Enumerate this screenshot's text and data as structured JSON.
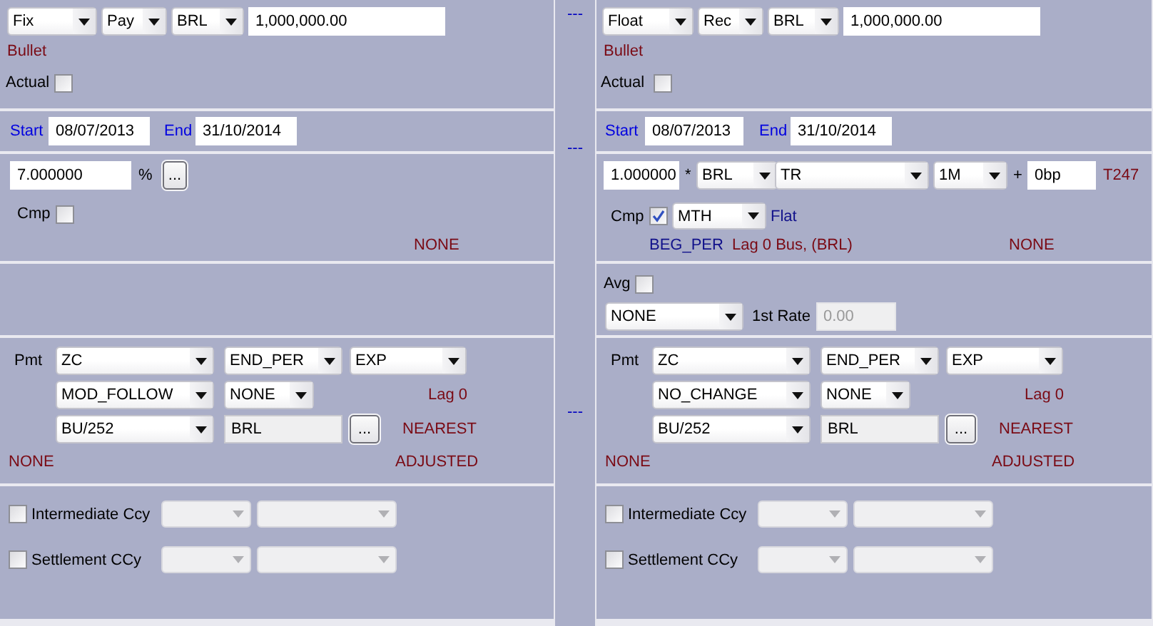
{
  "legs": [
    {
      "header": {
        "rows": [
          {
            "items": [
              {
                "kind": "dropdown",
                "value": "Fix",
                "disabled": false
              },
              {
                "kind": "dropdown",
                "value": "Pay",
                "disabled": false
              },
              {
                "kind": "dropdown",
                "value": "BRL",
                "disabled": false
              },
              {
                "kind": "field",
                "value": "1,000,000.00",
                "disabled": false,
                "readonly": false
              }
            ]
          },
          {
            "items": [
              {
                "kind": "hint",
                "text": "Bullet"
              }
            ]
          },
          {
            "items": [
              {
                "kind": "label",
                "text": "Actual"
              },
              {
                "kind": "checkbox",
                "checked": false
              }
            ]
          }
        ]
      },
      "dates": {
        "rows": [
          {
            "items": [
              {
                "kind": "caption",
                "text": "Start"
              },
              {
                "kind": "field",
                "value": "08/07/2013",
                "disabled": false,
                "readonly": false
              },
              {
                "kind": "caption",
                "text": "End"
              },
              {
                "kind": "field",
                "value": "31/10/2014",
                "disabled": false,
                "readonly": false
              }
            ]
          }
        ]
      },
      "rate": {
        "rows": [
          {
            "items": [
              {
                "kind": "field",
                "value": "7.000000",
                "disabled": false,
                "readonly": false
              },
              {
                "kind": "label",
                "text": "%"
              },
              {
                "kind": "button",
                "label": "..."
              }
            ]
          },
          {
            "items": [
              {
                "kind": "label",
                "text": "Cmp"
              },
              {
                "kind": "checkbox",
                "checked": false
              }
            ]
          },
          {
            "items": [
              {
                "kind": "hint",
                "text": "NONE"
              }
            ]
          }
        ]
      },
      "payment": {
        "rows": [
          {
            "items": [
              {
                "kind": "label",
                "text": "Pmt"
              },
              {
                "kind": "dropdown",
                "value": "ZC",
                "disabled": false
              },
              {
                "kind": "dropdown",
                "value": "END_PER",
                "disabled": false
              },
              {
                "kind": "dropdown",
                "value": "EXP",
                "disabled": false
              }
            ]
          },
          {
            "items": [
              {
                "kind": "dropdown",
                "value": "MOD_FOLLOW",
                "disabled": false
              },
              {
                "kind": "dropdown",
                "value": "NONE",
                "disabled": false
              },
              {
                "kind": "hint",
                "text": "Lag 0"
              }
            ]
          },
          {
            "items": [
              {
                "kind": "dropdown",
                "value": "BU/252",
                "disabled": false
              },
              {
                "kind": "field",
                "value": "BRL",
                "disabled": false,
                "readonly": true
              },
              {
                "kind": "button",
                "label": "..."
              },
              {
                "kind": "hint",
                "text": "NEAREST"
              }
            ]
          },
          {
            "items": [
              {
                "kind": "hint",
                "text": "NONE"
              },
              {
                "kind": "hint",
                "text": "ADJUSTED"
              }
            ]
          }
        ]
      },
      "currencies": {
        "rows": [
          {
            "items": [
              {
                "kind": "checkbox",
                "checked": false
              },
              {
                "kind": "label",
                "text": "Intermediate Ccy"
              },
              {
                "kind": "dropdown",
                "disabled": true
              },
              {
                "kind": "dropdown",
                "disabled": true
              }
            ]
          },
          {
            "items": [
              {
                "kind": "checkbox",
                "checked": false
              },
              {
                "kind": "label",
                "text": "Settlement CCy"
              },
              {
                "kind": "dropdown",
                "disabled": true
              },
              {
                "kind": "dropdown",
                "disabled": true
              }
            ]
          }
        ]
      }
    },
    {
      "header": {
        "rows": [
          {
            "items": [
              {
                "kind": "dropdown",
                "value": "Float",
                "disabled": false
              },
              {
                "kind": "dropdown",
                "value": "Rec",
                "disabled": false
              },
              {
                "kind": "dropdown",
                "value": "BRL",
                "disabled": false
              },
              {
                "kind": "field",
                "value": "1,000,000.00",
                "disabled": false,
                "readonly": false
              }
            ]
          },
          {
            "items": [
              {
                "kind": "hint",
                "text": "Bullet"
              }
            ]
          },
          {
            "items": [
              {
                "kind": "label",
                "text": "Actual"
              },
              {
                "kind": "checkbox",
                "checked": false
              }
            ]
          }
        ]
      },
      "dates": {
        "rows": [
          {
            "items": [
              {
                "kind": "caption",
                "text": "Start"
              },
              {
                "kind": "field",
                "value": "08/07/2013",
                "disabled": false,
                "readonly": false
              },
              {
                "kind": "caption",
                "text": "End"
              },
              {
                "kind": "field",
                "value": "31/10/2014",
                "disabled": false,
                "readonly": false
              }
            ]
          }
        ]
      },
      "rate": {
        "rows": [
          {
            "items": [
              {
                "kind": "field",
                "value": "1.000000",
                "disabled": false,
                "readonly": false
              },
              {
                "kind": "label",
                "text": "*"
              },
              {
                "kind": "dropdown",
                "value": "BRL",
                "disabled": false
              },
              {
                "kind": "dropdown",
                "value": "TR",
                "disabled": false
              },
              {
                "kind": "dropdown",
                "value": "1M",
                "disabled": false
              },
              {
                "kind": "label",
                "text": "+"
              },
              {
                "kind": "field",
                "value": "0bp",
                "disabled": false,
                "readonly": false
              },
              {
                "kind": "hint",
                "text": "T247"
              }
            ]
          },
          {
            "items": [
              {
                "kind": "label",
                "text": "Cmp"
              },
              {
                "kind": "checkbox",
                "checked": true
              },
              {
                "kind": "dropdown",
                "value": "MTH",
                "disabled": false
              },
              {
                "kind": "tag",
                "text": "Flat"
              }
            ]
          },
          {
            "items": [
              {
                "kind": "tag",
                "text": "BEG_PER"
              },
              {
                "kind": "hint",
                "text": "Lag 0 Bus, (BRL)"
              },
              {
                "kind": "hint",
                "text": "NONE"
              }
            ]
          }
        ]
      },
      "averaging": {
        "rows": [
          {
            "items": [
              {
                "kind": "label",
                "text": "Avg"
              },
              {
                "kind": "checkbox",
                "checked": false
              }
            ]
          },
          {
            "items": [
              {
                "kind": "dropdown",
                "value": "NONE",
                "disabled": false
              },
              {
                "kind": "label",
                "text": "1st Rate"
              },
              {
                "kind": "field",
                "value": "0.00",
                "disabled": true,
                "readonly": false
              }
            ]
          }
        ]
      },
      "payment": {
        "rows": [
          {
            "items": [
              {
                "kind": "label",
                "text": "Pmt"
              },
              {
                "kind": "dropdown",
                "value": "ZC",
                "disabled": false
              },
              {
                "kind": "dropdown",
                "value": "END_PER",
                "disabled": false
              },
              {
                "kind": "dropdown",
                "value": "EXP",
                "disabled": false
              }
            ]
          },
          {
            "items": [
              {
                "kind": "dropdown",
                "value": "NO_CHANGE",
                "disabled": false
              },
              {
                "kind": "dropdown",
                "value": "NONE",
                "disabled": false
              },
              {
                "kind": "hint",
                "text": "Lag 0"
              }
            ]
          },
          {
            "items": [
              {
                "kind": "dropdown",
                "value": "BU/252",
                "disabled": false
              },
              {
                "kind": "field",
                "value": "BRL",
                "disabled": false,
                "readonly": true
              },
              {
                "kind": "button",
                "label": "..."
              },
              {
                "kind": "hint",
                "text": "NEAREST"
              }
            ]
          },
          {
            "items": [
              {
                "kind": "hint",
                "text": "NONE"
              },
              {
                "kind": "hint",
                "text": "ADJUSTED"
              }
            ]
          }
        ]
      },
      "currencies": {
        "rows": [
          {
            "items": [
              {
                "kind": "checkbox",
                "checked": false
              },
              {
                "kind": "label",
                "text": "Intermediate Ccy"
              },
              {
                "kind": "dropdown",
                "disabled": true
              },
              {
                "kind": "dropdown",
                "disabled": true
              }
            ]
          },
          {
            "items": [
              {
                "kind": "checkbox",
                "checked": false
              },
              {
                "kind": "label",
                "text": "Settlement CCy"
              },
              {
                "kind": "dropdown",
                "disabled": true
              },
              {
                "kind": "dropdown",
                "disabled": true
              }
            ]
          }
        ]
      }
    }
  ],
  "separators": [
    "---",
    "---",
    "---"
  ]
}
